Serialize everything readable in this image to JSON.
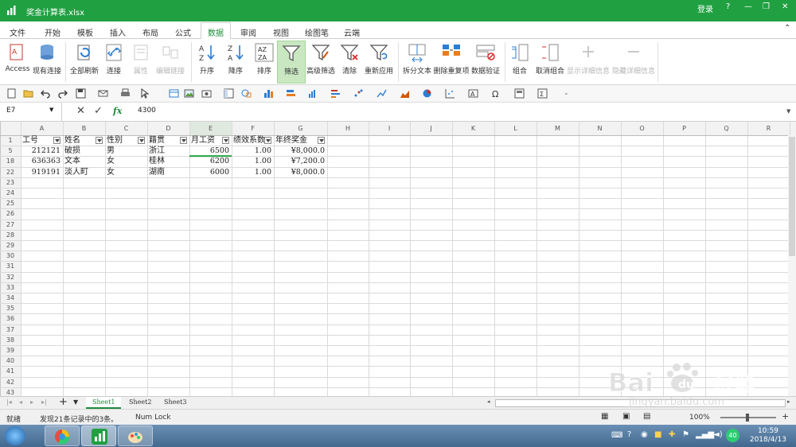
{
  "window": {
    "title": "奖金计算表.xlsx",
    "login": "登录",
    "help": "?"
  },
  "menu": {
    "tabs": [
      "文件",
      "开始",
      "模板",
      "插入",
      "布局",
      "公式",
      "数据",
      "审阅",
      "视图",
      "绘图笔",
      "云端"
    ]
  },
  "ribbon": {
    "buttons": [
      "Access",
      "现有连接",
      "全部刷新",
      "连接",
      "属性",
      "编辑链接",
      "升序",
      "降序",
      "排序",
      "筛选",
      "高级筛选",
      "清除",
      "重新应用",
      "拆分文本",
      "删除重复项",
      "数据验证",
      "组合",
      "取消组合",
      "显示详细信息",
      "隐藏详细信息"
    ]
  },
  "formula": {
    "namebox": "E7",
    "fx": "fx",
    "value": "4300"
  },
  "grid": {
    "col_letters": [
      "A",
      "B",
      "C",
      "D",
      "E",
      "F",
      "G",
      "H",
      "I",
      "J",
      "K",
      "L",
      "M",
      "N",
      "O",
      "P",
      "Q",
      "R"
    ],
    "row_numbers": [
      "1",
      "5",
      "18",
      "22",
      "23",
      "24",
      "25",
      "26",
      "27",
      "28",
      "29",
      "30",
      "31",
      "32",
      "33",
      "34",
      "35",
      "36",
      "37",
      "38",
      "39",
      "40",
      "41",
      "42",
      "43"
    ],
    "header": [
      "工号",
      "姓名",
      "性别",
      "籍贯",
      "月工资",
      "绩效系数",
      "年终奖金"
    ],
    "rows": [
      [
        "212121",
        "破损",
        "男",
        "浙江",
        "6500",
        "1.00",
        "¥8,000.0"
      ],
      [
        "636363",
        "文本",
        "女",
        "桂林",
        "6200",
        "1.00",
        "¥7,200.0"
      ],
      [
        "919191",
        "淡人町",
        "女",
        "湖南",
        "6000",
        "1.00",
        "¥8,000.0"
      ]
    ]
  },
  "sheets": {
    "tabs": [
      "Sheet1",
      "Sheet2",
      "Sheet3"
    ]
  },
  "status": {
    "ready": "就绪",
    "found": "发现21条记录中的3条。",
    "numlock": "Num Lock",
    "zoom": "100%"
  },
  "taskbar": {
    "time": "10:59",
    "date": "2018/4/13",
    "badge": "40"
  },
  "watermark": {
    "text": "Baidu经验",
    "sub": "jingyan.baidu.com"
  },
  "colors": {
    "accent": "#21a042",
    "filter_active": "#c9e8c2"
  }
}
